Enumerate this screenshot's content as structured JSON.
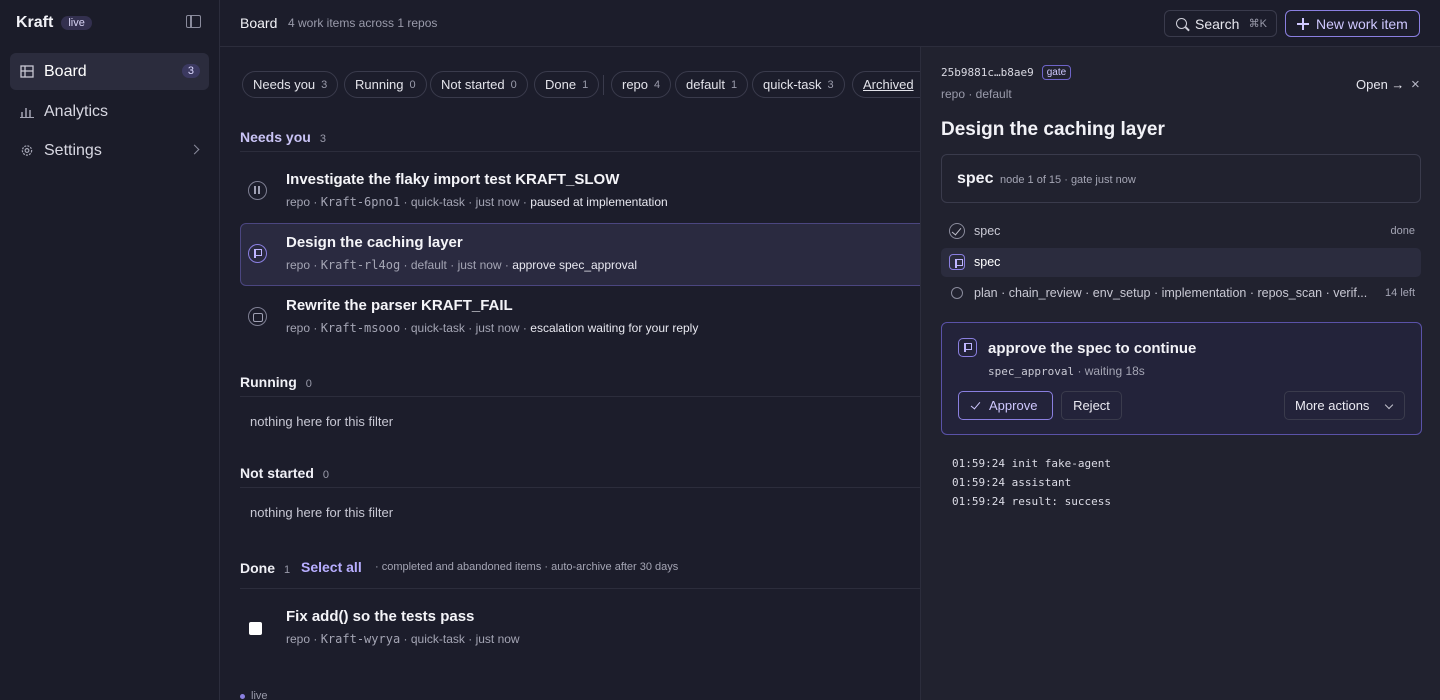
{
  "app": {
    "name": "Kraft",
    "live_badge": "live"
  },
  "sidebar": {
    "items": [
      {
        "label": "Board",
        "count": "3"
      },
      {
        "label": "Analytics"
      },
      {
        "label": "Settings"
      }
    ]
  },
  "header": {
    "title": "Board",
    "subtitle": "4 work items across 1 repos",
    "search_label": "Search",
    "search_shortcut": "⌘K",
    "new_label": "New work item"
  },
  "filters": [
    {
      "label": "Needs you",
      "count": "3"
    },
    {
      "label": "Running",
      "count": "0"
    },
    {
      "label": "Not started",
      "count": "0"
    },
    {
      "label": "Done",
      "count": "1"
    },
    {
      "label": "repo",
      "count": "4"
    },
    {
      "label": "default",
      "count": "1"
    },
    {
      "label": "quick-task",
      "count": "3"
    },
    {
      "label": "Archived"
    }
  ],
  "sections": {
    "needs": {
      "title": "Needs you",
      "count": "3",
      "items": [
        {
          "title": "Investigate the flaky import test KRAFT_SLOW",
          "repo": "repo",
          "id": "Kraft-6pno1",
          "type": "quick-task",
          "time": "just now",
          "status": "paused at implementation"
        },
        {
          "title": "Design the caching layer",
          "repo": "repo",
          "id": "Kraft-rl4og",
          "type": "default",
          "time": "just now",
          "status": "approve spec_approval"
        },
        {
          "title": "Rewrite the parser KRAFT_FAIL",
          "repo": "repo",
          "id": "Kraft-msooo",
          "type": "quick-task",
          "time": "just now",
          "status": "escalation waiting for your reply"
        }
      ]
    },
    "running": {
      "title": "Running",
      "count": "0",
      "empty": "nothing here for this filter"
    },
    "not_started": {
      "title": "Not started",
      "count": "0",
      "empty": "nothing here for this filter"
    },
    "done": {
      "title": "Done",
      "count": "1",
      "select_all": "Select all",
      "note": "· completed and abandoned items · auto-archive after 30 days",
      "items": [
        {
          "title": "Fix add() so the tests pass",
          "repo": "repo",
          "id": "Kraft-wyrya",
          "type": "quick-task",
          "time": "just now"
        }
      ]
    }
  },
  "footer": {
    "live": "live"
  },
  "panel": {
    "id": "25b9881c…b8ae9",
    "badge": "gate",
    "repo_line": "repo · default",
    "open_label": "Open →",
    "close_label": "×",
    "title": "Design the caching layer",
    "spec": {
      "name": "spec",
      "info": "node 1 of 15 · gate just now"
    },
    "steps": [
      {
        "label": "spec",
        "right": "done"
      },
      {
        "label": "spec"
      },
      {
        "label": "plan · chain_review · env_setup · implementation · repos_scan · verif...",
        "right": "14 left"
      }
    ],
    "gate": {
      "title": "approve the spec to continue",
      "gate_name": "spec_approval",
      "wait": "· waiting 18s",
      "approve": "Approve",
      "reject": "Reject",
      "more": "More actions"
    },
    "logs": [
      "01:59:24 init fake-agent",
      "01:59:24 assistant",
      "01:59:24 result: success"
    ]
  }
}
